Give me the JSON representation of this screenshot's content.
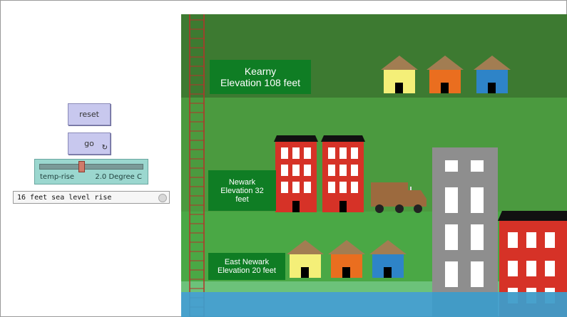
{
  "controls": {
    "reset_label": "reset",
    "go_label": "go",
    "go_icon": "forever-loop-icon",
    "slider": {
      "name": "temp-rise",
      "value_text": "2.0 Degree C",
      "value_fraction": 0.4
    },
    "monitor_text": "16 feet sea level rise"
  },
  "world": {
    "kearny": {
      "name": "Kearny",
      "elevation": "Elevation 108 feet"
    },
    "newark": {
      "name": "Newark",
      "elevation_line1": "Elevation 32",
      "elevation_line2": "feet"
    },
    "east_newark": {
      "name": "East Newark",
      "elevation": "Elevation 20 feet"
    },
    "colors": {
      "high_land": "#3d7a31",
      "mid_land": "#4b9a3f",
      "low_land": "#4aa845",
      "water": "#3e9cc9",
      "label_bg": "#0f7d24",
      "ladder": "#b5322a"
    }
  }
}
